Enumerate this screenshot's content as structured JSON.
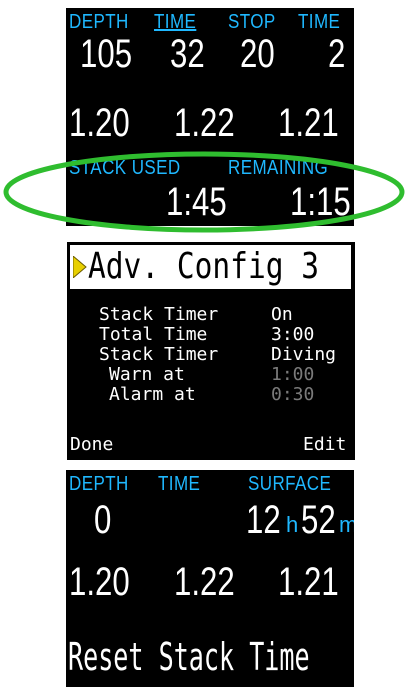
{
  "screen1": {
    "headers": {
      "depth": "DEPTH",
      "time": "TIME",
      "stop": "STOP",
      "stop_time": "TIME"
    },
    "values": {
      "depth": "105",
      "time": "32",
      "stop": "20",
      "stop_time": "2"
    },
    "ppo2": [
      "1.20",
      "1.22",
      "1.21"
    ],
    "stack": {
      "used_label": "STACK USED",
      "remaining_label": "REMAINING",
      "used_value": "1:45",
      "remaining_value": "1:15"
    },
    "highlight_color": "#2fbd2f"
  },
  "screen2": {
    "title": "Adv. Config 3",
    "rows": [
      {
        "label": "Stack Timer",
        "value": "On"
      },
      {
        "label": "Total Time",
        "value": "3:00"
      },
      {
        "label": "Stack Timer",
        "value": "Diving"
      },
      {
        "label": "Warn at",
        "value": "1:00"
      },
      {
        "label": "Alarm at",
        "value": "0:30"
      }
    ],
    "footer": {
      "left": "Done",
      "right": "Edit"
    },
    "pointer_color": "#e8d000"
  },
  "screen3": {
    "headers": {
      "depth": "DEPTH",
      "time": "TIME",
      "surface": "SURFACE"
    },
    "values": {
      "depth": "0",
      "surface_hours": "12",
      "hours_unit": "h",
      "surface_minutes": "52",
      "minutes_unit": "m"
    },
    "ppo2": [
      "1.20",
      "1.22",
      "1.21"
    ],
    "action": "Reset Stack Time"
  },
  "colors": {
    "accent": "#1fb8ff",
    "background": "#000000",
    "text": "#ffffff",
    "disabled": "#7a7a7a"
  }
}
